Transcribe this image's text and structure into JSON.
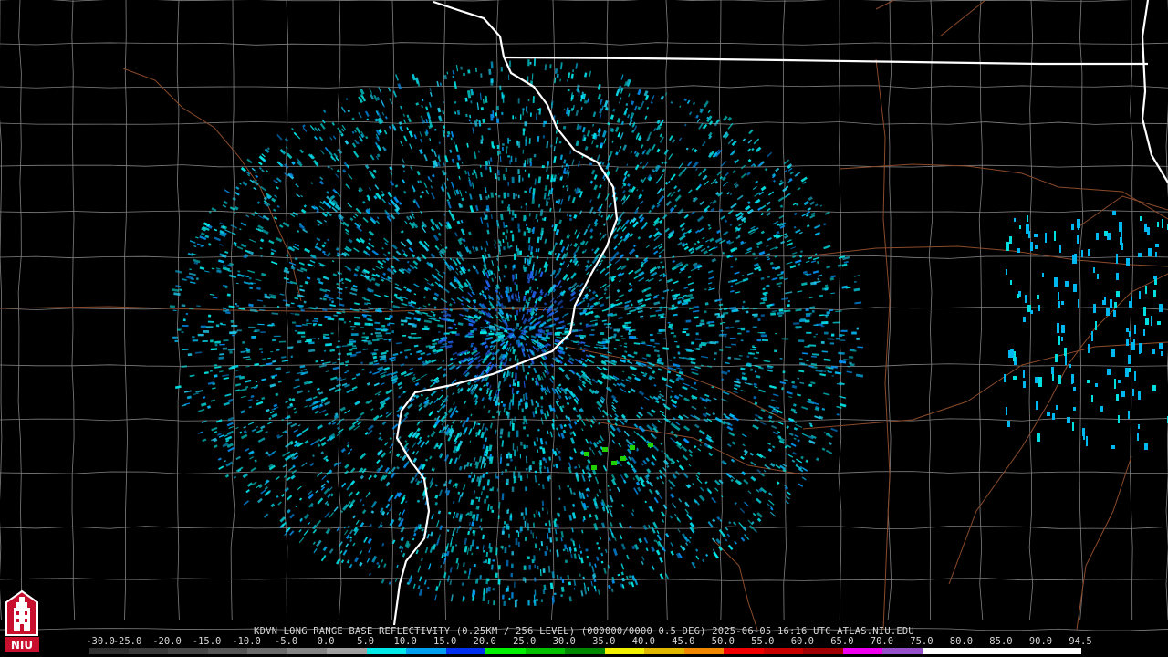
{
  "caption": {
    "text": "KDVN LONG RANGE BASE REFLECTIVITY (0.25KM / 256 LEVEL) (000000/0000 0.5 DEG) 2025-06-05 16:16 UTC  ATLAS.NIU.EDU"
  },
  "logo": {
    "text": "NIU"
  },
  "color_scale": {
    "labels": [
      "-30.0",
      "-25.0",
      "-20.0",
      "-15.0",
      "-10.0",
      "-5.0",
      "0.0",
      "5.0",
      "10.0",
      "15.0",
      "20.0",
      "25.0",
      "30.0",
      "35.0",
      "40.0",
      "45.0",
      "50.0",
      "55.0",
      "60.0",
      "65.0",
      "70.0",
      "75.0",
      "80.0",
      "85.0",
      "90.0",
      "94.5"
    ],
    "colors": [
      "#303030",
      "#3a3a3a",
      "#464646",
      "#555555",
      "#6a6a6a",
      "#848484",
      "#a0a0a0",
      "#00e8e8",
      "#00a0f0",
      "#0030f0",
      "#00f000",
      "#00c000",
      "#008800",
      "#f0f000",
      "#e0b800",
      "#f08800",
      "#f00000",
      "#c80000",
      "#a00000",
      "#f000f0",
      "#9850c8",
      "#ffffff",
      "#ffffff",
      "#ffffff",
      "#ffffff"
    ]
  },
  "map": {
    "radar_site": "KDVN",
    "legend_colors": {
      "background": "#000000",
      "county_lines": "#808080",
      "highways": "#8b4a2b",
      "state_lines": "#ffffff"
    }
  }
}
